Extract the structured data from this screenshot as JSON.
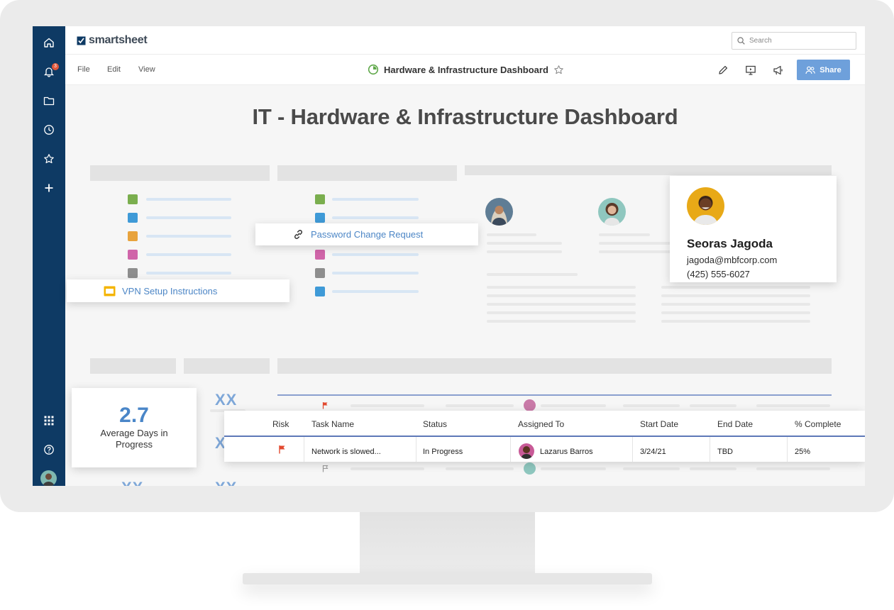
{
  "app": {
    "logo": "smartsheet"
  },
  "search": {
    "placeholder": "Search"
  },
  "nav": {
    "icons": [
      "home-icon",
      "bell-icon",
      "folder-icon",
      "clock-icon",
      "star-icon",
      "plus-icon",
      "grid-icon",
      "help-icon"
    ],
    "notification_count": "3"
  },
  "menu": {
    "file": "File",
    "edit": "Edit",
    "view": "View"
  },
  "document": {
    "title": "Hardware & Infrastructure Dashboard"
  },
  "toolbar": {
    "share_label": "Share"
  },
  "dashboard": {
    "title": "IT - Hardware & Infrastructure Dashboard",
    "links": {
      "password": "Password Change Request",
      "vpn": "VPN Setup Instructions"
    },
    "contact": {
      "name": "Seoras Jagoda",
      "email": "jagoda@mbfcorp.com",
      "phone": "(425) 555-6027"
    },
    "metric": {
      "value": "2.7",
      "label": "Average Days in Progress"
    },
    "placeholder_metric": "XX"
  },
  "table": {
    "headers": [
      "Risk",
      "Task Name",
      "Status",
      "Assigned To",
      "Start Date",
      "End Date",
      "% Complete"
    ],
    "row": {
      "task": "Network is slowed...",
      "status": "In Progress",
      "assigned": "Lazarus Barros",
      "start": "3/24/21",
      "end": "TBD",
      "complete": "25%"
    }
  },
  "colors": {
    "nav": "#0e3a64",
    "accent": "#6ea0db",
    "link": "#4c86c6",
    "flag": "#e2492f",
    "legend": [
      "#7aae4e",
      "#3f9ad7",
      "#e8a33d",
      "#d065a9",
      "#8e8e8e",
      "#3f9ad7"
    ]
  }
}
